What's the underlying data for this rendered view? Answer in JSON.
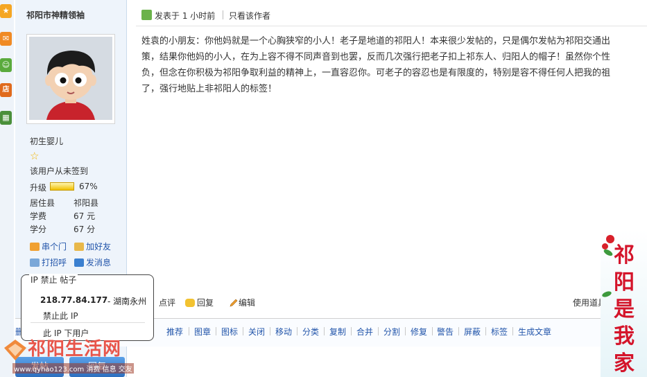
{
  "user": {
    "name": "祁阳市神精领袖",
    "rank": "初生婴儿",
    "sign_status": "该用户从未签到",
    "level_label": "升级",
    "level_progress": 67,
    "level_text": "67%",
    "fields": [
      {
        "label": "居住县",
        "value": "祁阳县"
      },
      {
        "label": "学费",
        "value": "67 元"
      },
      {
        "label": "学分",
        "value": "67 分"
      }
    ],
    "links": {
      "visit": "串个门",
      "add_friend": "加好友",
      "greet": "打招呼",
      "message": "发消息"
    }
  },
  "post": {
    "posted": "发表于 1 小时前",
    "only_author": "只看该作者",
    "lines": [
      "姓袁的小朋友：你他妈就是一个心胸狭窄的小人！老子是地道的祁阳人！本来很少发帖的，只是偶尔发帖为祁阳交通出",
      "策，结果你他妈的小人，在为上容不得不同声音到也罢，反而几次强行把老子扣上祁东人、归阳人的帽子！虽然你个性",
      "负，但念在你积极为祁阳争取利益的精神上，一直容忍你。可老子的容忍也是有限度的，特别是容不得任何人把我的祖",
      "了，强行地贴上非祁阳人的标签！"
    ]
  },
  "actions": {
    "rate": "点评",
    "reply": "回复",
    "edit": "编辑",
    "use_tool": "使用道具"
  },
  "moderation": [
    "删除",
    "推荐",
    "图章",
    "图标",
    "关闭",
    "移动",
    "分类",
    "复制",
    "合并",
    "分割",
    "修复",
    "警告",
    "屏蔽",
    "标签",
    "生成文章"
  ],
  "ip_popup": {
    "tabs": "IP  禁止  帖子",
    "ip": "218.77.84.177",
    "location": " - 湖南永州",
    "ban_ip": "禁止此 IP",
    "users_under_ip": "此 IP 下用户"
  },
  "bottom": {
    "post_button": "发帖",
    "reply_button": "回复",
    "logo": "祁阳生活网",
    "logo_sub": "www.qyhao123.com 消费 信息 交友"
  },
  "banner": {
    "chars": [
      "祁",
      "阳",
      "是",
      "我",
      "家"
    ]
  },
  "colors": {
    "link": "#2255aa",
    "banner_red": "#d4142a",
    "level_bar": "#f0c000"
  }
}
